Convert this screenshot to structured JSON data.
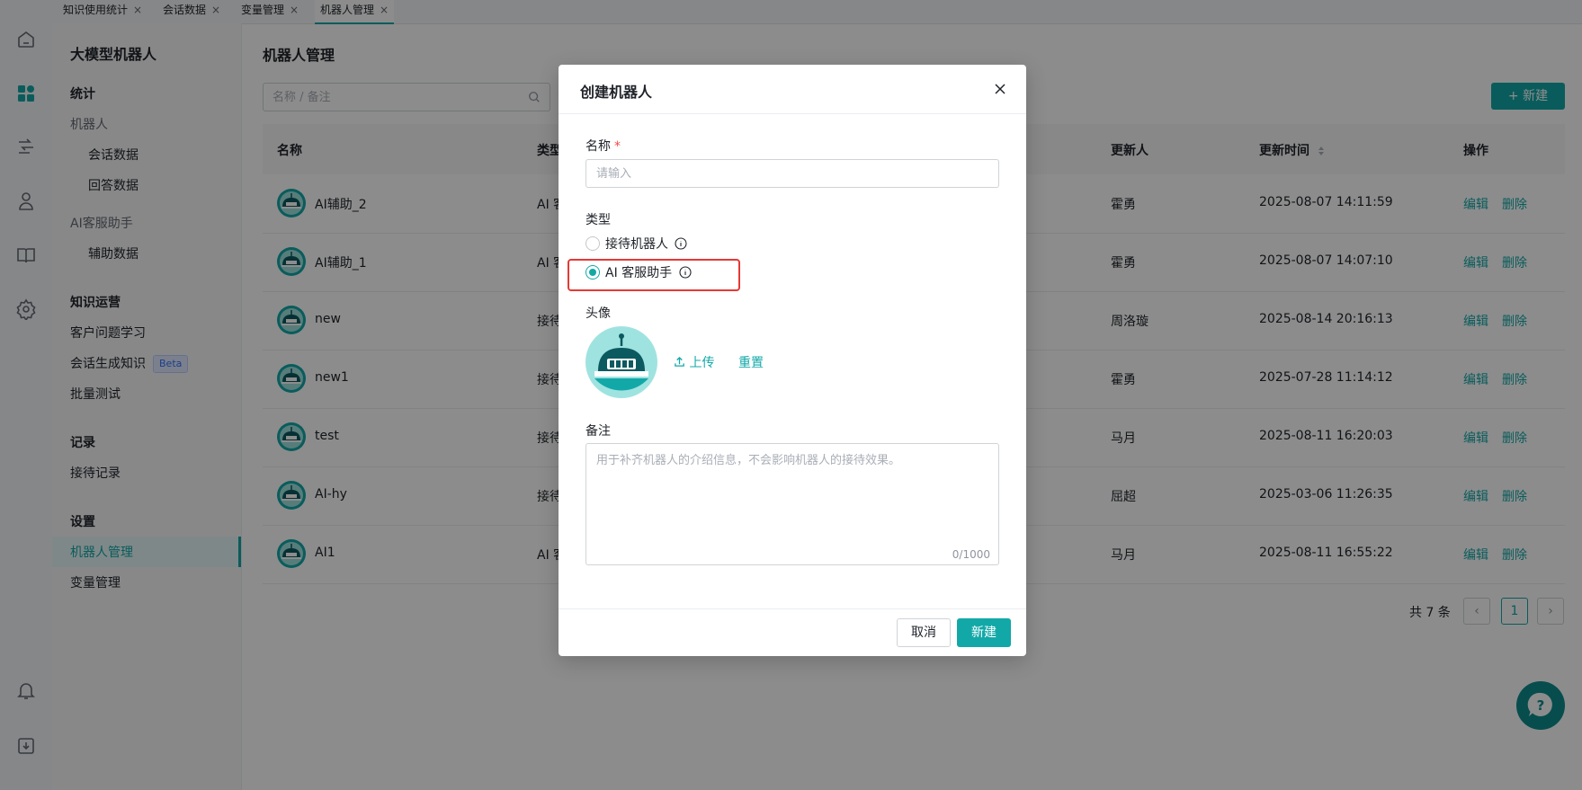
{
  "tabs": [
    {
      "label": "知识使用统计"
    },
    {
      "label": "会话数据"
    },
    {
      "label": "变量管理"
    },
    {
      "label": "机器人管理"
    }
  ],
  "tab_close": "×",
  "rail": [
    "home-icon",
    "dashboard-icon",
    "flow-icon",
    "user-icon",
    "book-icon",
    "gear-icon",
    "bell-icon",
    "download-icon"
  ],
  "subnav": {
    "title": "大模型机器人",
    "stats_group": "统计",
    "robot": "机器人",
    "session_data": "会话数据",
    "answer_data": "回答数据",
    "ai_assistant": "AI客服助手",
    "assist_data": "辅助数据",
    "ops_group": "知识运营",
    "customer_learning": "客户问题学习",
    "gen_knowledge": "会话生成知识",
    "beta": "Beta",
    "batch_test": "批量测试",
    "records_group": "记录",
    "reception_records": "接待记录",
    "settings_group": "设置",
    "robot_mgmt": "机器人管理",
    "var_mgmt": "变量管理"
  },
  "main": {
    "title": "机器人管理",
    "search_placeholder": "名称 / 备注",
    "new_button": "+ 新建"
  },
  "table": {
    "headers": {
      "name": "名称",
      "type": "类型",
      "updater": "更新人",
      "updated_at": "更新时间",
      "actions": "操作"
    },
    "rows": [
      {
        "name": "AI辅助_2",
        "type": "AI 客",
        "updater": "霍勇",
        "updated_at": "2025-08-07 14:11:59"
      },
      {
        "name": "AI辅助_1",
        "type": "AI 客",
        "updater": "霍勇",
        "updated_at": "2025-08-07 14:07:10"
      },
      {
        "name": "new",
        "type": "接待",
        "updater": "周洛璇",
        "updated_at": "2025-08-14 20:16:13"
      },
      {
        "name": "new1",
        "type": "接待",
        "updater": "霍勇",
        "updated_at": "2025-07-28 11:14:12"
      },
      {
        "name": "test",
        "type": "接待",
        "updater": "马月",
        "updated_at": "2025-08-11 16:20:03"
      },
      {
        "name": "AI-hy",
        "type": "接待",
        "updater": "屈超",
        "updated_at": "2025-03-06 11:26:35"
      },
      {
        "name": "AI1",
        "type": "AI 客",
        "updater": "马月",
        "updated_at": "2025-08-11 16:55:22"
      }
    ],
    "edit": "编辑",
    "delete": "删除"
  },
  "pager": {
    "total": "共 7 条",
    "prev": "‹",
    "page": "1",
    "next": "›"
  },
  "help": "?",
  "modal": {
    "title": "创建机器人",
    "name_label": "名称",
    "required_mark": "*",
    "name_placeholder": "请输入",
    "type_label": "类型",
    "type_options": [
      {
        "label": "接待机器人",
        "selected": false
      },
      {
        "label": "AI 客服助手",
        "selected": true
      }
    ],
    "avatar_label": "头像",
    "upload": "上传",
    "reset": "重置",
    "remark_label": "备注",
    "remark_placeholder": "用于补齐机器人的介绍信息，不会影响机器人的接待效果。",
    "remark_count": "0/1000",
    "cancel": "取消",
    "create": "新建"
  },
  "colors": {
    "accent": "#13a8a8",
    "highlight": "#e53935"
  }
}
